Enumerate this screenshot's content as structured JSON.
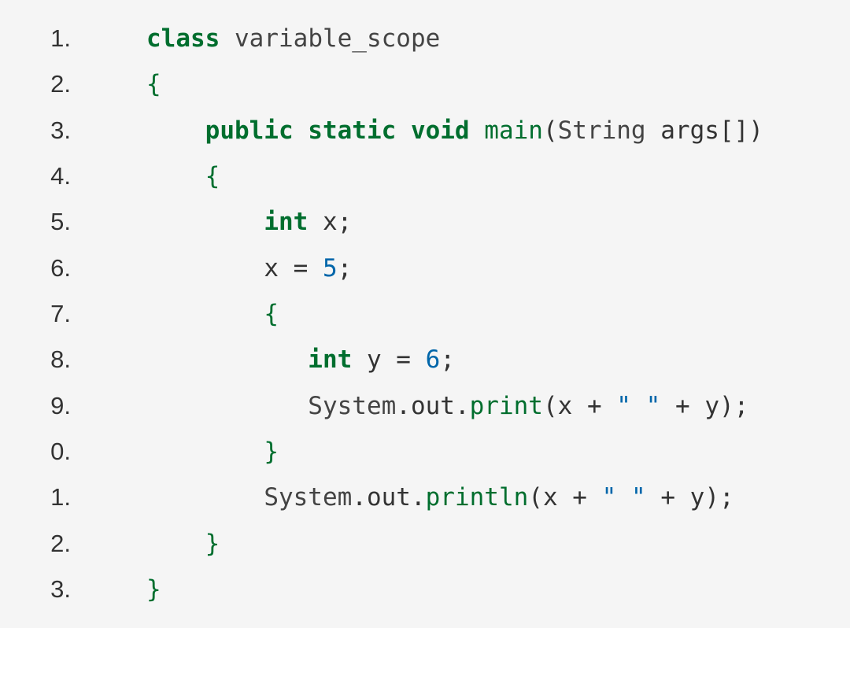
{
  "code": {
    "lines": [
      {
        "number": "1.",
        "indent": "   ",
        "tokens": [
          {
            "cls": "kw",
            "text": "class"
          },
          {
            "cls": "",
            "text": " "
          },
          {
            "cls": "cls",
            "text": "variable_scope"
          }
        ]
      },
      {
        "number": "2.",
        "indent": "   ",
        "tokens": [
          {
            "cls": "brace",
            "text": "{"
          }
        ]
      },
      {
        "number": "3.",
        "indent": "       ",
        "tokens": [
          {
            "cls": "kw",
            "text": "public static void"
          },
          {
            "cls": "",
            "text": " "
          },
          {
            "cls": "call",
            "text": "main"
          },
          {
            "cls": "punct",
            "text": "("
          },
          {
            "cls": "cls",
            "text": "String"
          },
          {
            "cls": "",
            "text": " "
          },
          {
            "cls": "var",
            "text": "args"
          },
          {
            "cls": "punct",
            "text": "[])"
          }
        ]
      },
      {
        "number": "4.",
        "indent": "       ",
        "tokens": [
          {
            "cls": "brace",
            "text": "{"
          }
        ]
      },
      {
        "number": "5.",
        "indent": "           ",
        "tokens": [
          {
            "cls": "kw",
            "text": "int"
          },
          {
            "cls": "",
            "text": " "
          },
          {
            "cls": "var",
            "text": "x"
          },
          {
            "cls": "punct",
            "text": ";"
          }
        ]
      },
      {
        "number": "6.",
        "indent": "           ",
        "tokens": [
          {
            "cls": "var",
            "text": "x "
          },
          {
            "cls": "punct",
            "text": "="
          },
          {
            "cls": "",
            "text": " "
          },
          {
            "cls": "num",
            "text": "5"
          },
          {
            "cls": "punct",
            "text": ";"
          }
        ]
      },
      {
        "number": "7.",
        "indent": "           ",
        "tokens": [
          {
            "cls": "brace",
            "text": "{"
          }
        ]
      },
      {
        "number": "8.",
        "indent": "              ",
        "tokens": [
          {
            "cls": "kw",
            "text": "int"
          },
          {
            "cls": "",
            "text": " "
          },
          {
            "cls": "var",
            "text": "y "
          },
          {
            "cls": "punct",
            "text": "="
          },
          {
            "cls": "",
            "text": " "
          },
          {
            "cls": "num",
            "text": "6"
          },
          {
            "cls": "punct",
            "text": ";"
          }
        ]
      },
      {
        "number": "9.",
        "indent": "              ",
        "tokens": [
          {
            "cls": "cls",
            "text": "System"
          },
          {
            "cls": "punct",
            "text": "."
          },
          {
            "cls": "obj",
            "text": "out"
          },
          {
            "cls": "punct",
            "text": "."
          },
          {
            "cls": "call",
            "text": "print"
          },
          {
            "cls": "punct",
            "text": "("
          },
          {
            "cls": "var",
            "text": "x "
          },
          {
            "cls": "punct",
            "text": "+"
          },
          {
            "cls": "",
            "text": " "
          },
          {
            "cls": "str",
            "text": "\" \""
          },
          {
            "cls": "",
            "text": " "
          },
          {
            "cls": "punct",
            "text": "+"
          },
          {
            "cls": "",
            "text": " "
          },
          {
            "cls": "var",
            "text": "y"
          },
          {
            "cls": "punct",
            "text": ");"
          }
        ]
      },
      {
        "number": "0.",
        "indent": "           ",
        "tokens": [
          {
            "cls": "brace",
            "text": "}"
          }
        ]
      },
      {
        "number": "1.",
        "indent": "           ",
        "tokens": [
          {
            "cls": "cls",
            "text": "System"
          },
          {
            "cls": "punct",
            "text": "."
          },
          {
            "cls": "obj",
            "text": "out"
          },
          {
            "cls": "punct",
            "text": "."
          },
          {
            "cls": "call",
            "text": "println"
          },
          {
            "cls": "punct",
            "text": "("
          },
          {
            "cls": "var",
            "text": "x "
          },
          {
            "cls": "punct",
            "text": "+"
          },
          {
            "cls": "",
            "text": " "
          },
          {
            "cls": "str",
            "text": "\" \""
          },
          {
            "cls": "",
            "text": " "
          },
          {
            "cls": "punct",
            "text": "+"
          },
          {
            "cls": "",
            "text": " "
          },
          {
            "cls": "var",
            "text": "y"
          },
          {
            "cls": "punct",
            "text": ");"
          }
        ]
      },
      {
        "number": "2.",
        "indent": "       ",
        "tokens": [
          {
            "cls": "brace",
            "text": "}"
          }
        ]
      },
      {
        "number": "3.",
        "indent": "   ",
        "tokens": [
          {
            "cls": "brace",
            "text": "}"
          }
        ]
      }
    ]
  }
}
